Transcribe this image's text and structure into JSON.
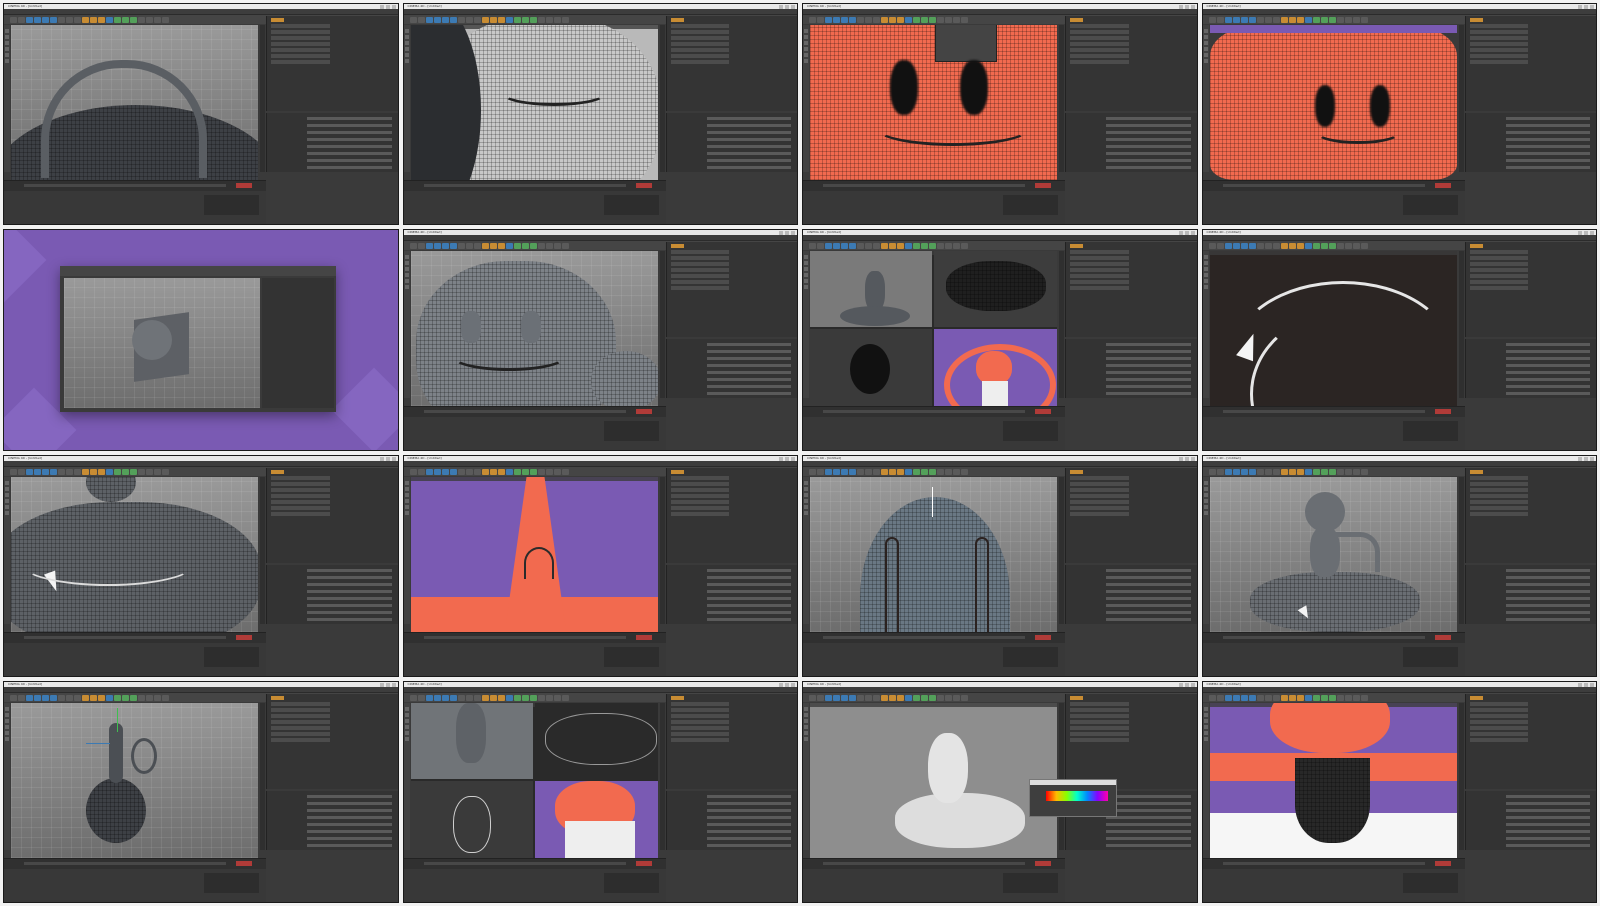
{
  "layout": {
    "columns": 4,
    "rows": 4,
    "tile_count": 16
  },
  "app": {
    "title": "CINEMA 4D - [Untitled]"
  },
  "colors": {
    "page_bg": "#f2f2f2",
    "ui_dark": "#3a3a3a",
    "coral": "#f26a4f",
    "purple": "#7a5ab3",
    "record_red": "#b03b38",
    "accent_orange": "#c88c33"
  },
  "tiles": [
    {
      "scene": "handle-on-dome"
    },
    {
      "scene": "closeup-mesh-mouth"
    },
    {
      "scene": "coral-face-flat"
    },
    {
      "scene": "coral-face-curved"
    },
    {
      "scene": "purple-intro-cube"
    },
    {
      "scene": "grey-head-face"
    },
    {
      "scene": "four-view-layout"
    },
    {
      "scene": "dark-curves"
    },
    {
      "scene": "donut-closeup"
    },
    {
      "scene": "coral-arch-purple"
    },
    {
      "scene": "arch-with-bars"
    },
    {
      "scene": "monkey-on-donut"
    },
    {
      "scene": "hanging-figure"
    },
    {
      "scene": "four-view-wire"
    },
    {
      "scene": "wire-figure-color-picker"
    },
    {
      "scene": "coral-purple-final"
    }
  ]
}
